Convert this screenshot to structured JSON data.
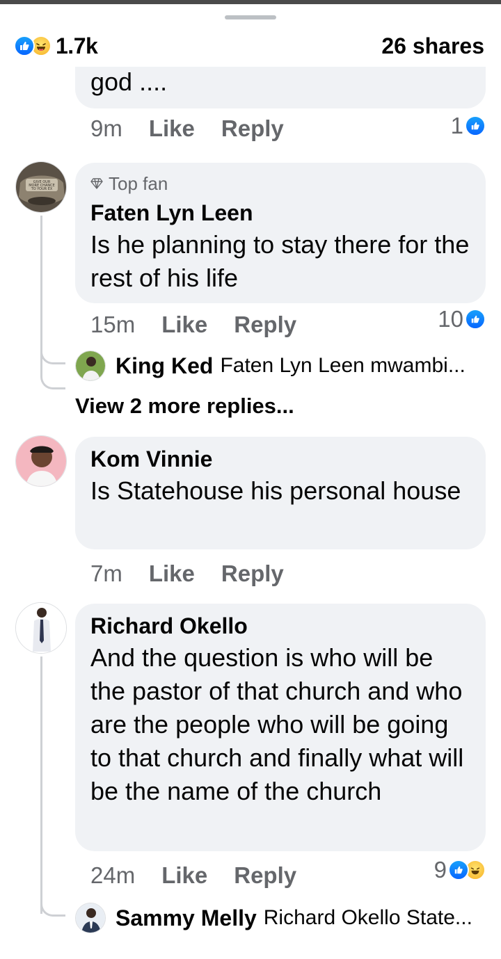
{
  "summary": {
    "reaction_count": "1.7k",
    "shares": "26 shares",
    "reactions": [
      "like-icon",
      "haha-icon"
    ]
  },
  "comments": [
    {
      "text": "god ....",
      "time": "9m",
      "like_label": "Like",
      "reply_label": "Reply",
      "reaction_count": "1"
    },
    {
      "badge": "Top fan",
      "author": "Faten Lyn Leen",
      "text": "Is he planning to stay there for the rest of his life",
      "time": "15m",
      "like_label": "Like",
      "reply_label": "Reply",
      "reaction_count": "10",
      "reply_preview": {
        "author": "King Ked",
        "text": "Faten Lyn Leen mwambi..."
      },
      "view_more": "View 2 more replies..."
    },
    {
      "author": "Kom Vinnie",
      "text": "Is Statehouse his personal house",
      "time": "7m",
      "like_label": "Like",
      "reply_label": "Reply"
    },
    {
      "author": "Richard Okello",
      "text": "And the question is who will be the pastor of that church and who are the people who will be going to that church and finally what will be the name of the church",
      "time": "24m",
      "like_label": "Like",
      "reply_label": "Reply",
      "reaction_count": "9",
      "reply_preview": {
        "author": "Sammy Melly",
        "text": "Richard Okello State..."
      }
    }
  ],
  "colors": {
    "like_blue": "#0866ff",
    "bubble": "#f0f2f5",
    "secondary_text": "#65676b"
  }
}
